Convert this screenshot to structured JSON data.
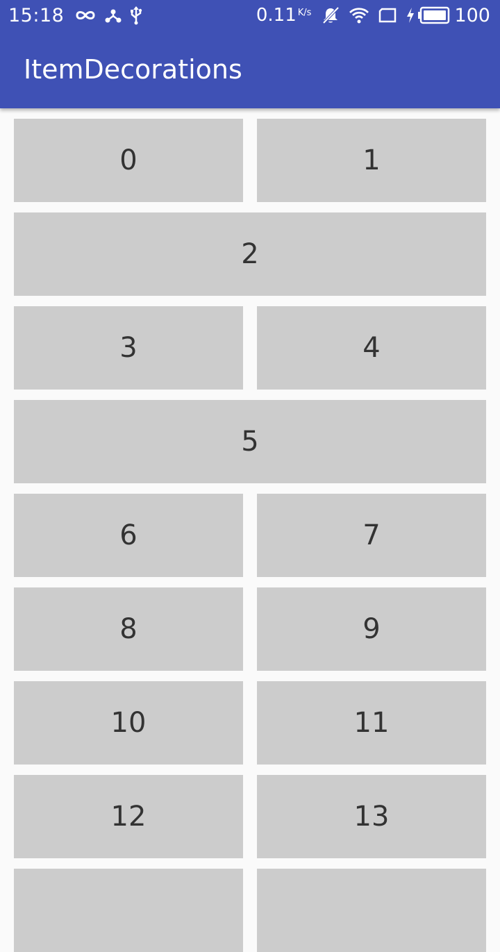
{
  "status_bar": {
    "time": "15:18",
    "left_icons": [
      "infinity-icon",
      "network-share-icon",
      "usb-icon"
    ],
    "net_speed": "0.11",
    "net_speed_unit": "K/s",
    "right_icons": [
      "muted-bell-icon",
      "wifi-icon",
      "sim-icon",
      "charging-icon",
      "battery-icon"
    ],
    "battery_level": "100"
  },
  "app_bar": {
    "title": "ItemDecorations",
    "color": "#3f51b5"
  },
  "grid": {
    "item_color": "#cccccc",
    "items": [
      {
        "label": "0",
        "span": 1
      },
      {
        "label": "1",
        "span": 1
      },
      {
        "label": "2",
        "span": 2
      },
      {
        "label": "3",
        "span": 1
      },
      {
        "label": "4",
        "span": 1
      },
      {
        "label": "5",
        "span": 2
      },
      {
        "label": "6",
        "span": 1
      },
      {
        "label": "7",
        "span": 1
      },
      {
        "label": "8",
        "span": 1
      },
      {
        "label": "9",
        "span": 1
      },
      {
        "label": "10",
        "span": 1
      },
      {
        "label": "11",
        "span": 1
      },
      {
        "label": "12",
        "span": 1
      },
      {
        "label": "13",
        "span": 1
      },
      {
        "label": "",
        "span": 1
      },
      {
        "label": "",
        "span": 1
      }
    ]
  }
}
